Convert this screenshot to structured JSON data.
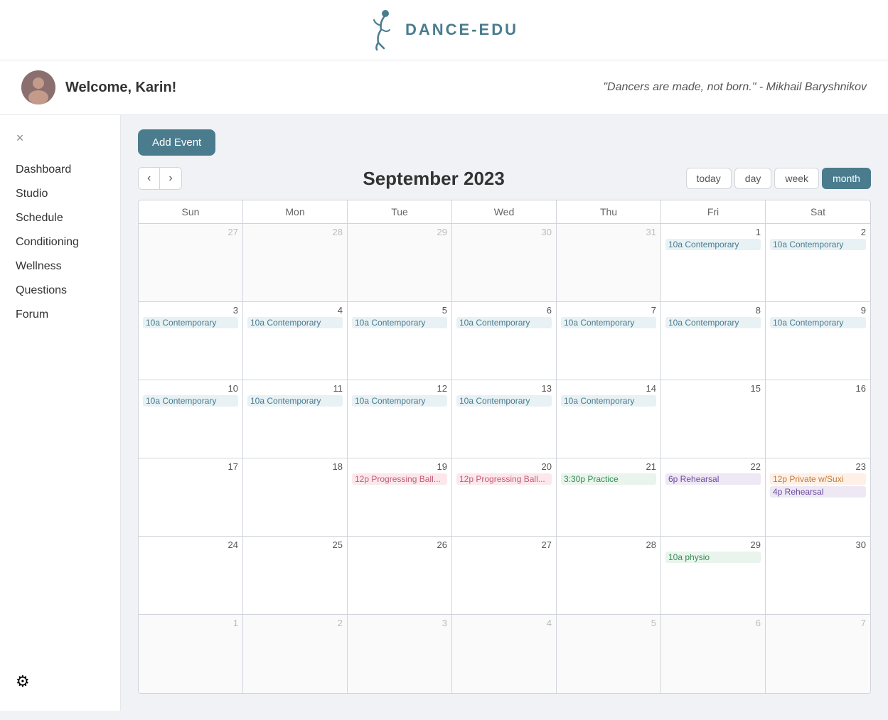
{
  "header": {
    "logo_text": "DANCE-EDU",
    "quote": "\"Dancers are made, not born.\" - Mikhail Baryshnikov",
    "welcome": "Welcome, Karin!"
  },
  "sidebar": {
    "close_icon": "×",
    "items": [
      {
        "label": "Dashboard",
        "id": "dashboard"
      },
      {
        "label": "Studio",
        "id": "studio"
      },
      {
        "label": "Schedule",
        "id": "schedule"
      },
      {
        "label": "Conditioning",
        "id": "conditioning"
      },
      {
        "label": "Wellness",
        "id": "wellness"
      },
      {
        "label": "Questions",
        "id": "questions"
      },
      {
        "label": "Forum",
        "id": "forum"
      }
    ],
    "settings_icon": "⚙"
  },
  "toolbar": {
    "add_event_label": "Add Event"
  },
  "calendar": {
    "month_title": "September 2023",
    "view_buttons": [
      {
        "label": "today",
        "id": "today",
        "active": false
      },
      {
        "label": "day",
        "id": "day",
        "active": false
      },
      {
        "label": "week",
        "id": "week",
        "active": false
      },
      {
        "label": "month",
        "id": "month",
        "active": true
      }
    ],
    "day_headers": [
      "Sun",
      "Mon",
      "Tue",
      "Wed",
      "Thu",
      "Fri",
      "Sat"
    ],
    "weeks": [
      [
        {
          "num": "27",
          "other": true,
          "events": []
        },
        {
          "num": "28",
          "other": true,
          "events": []
        },
        {
          "num": "29",
          "other": true,
          "events": []
        },
        {
          "num": "30",
          "other": true,
          "events": []
        },
        {
          "num": "31",
          "other": true,
          "events": []
        },
        {
          "num": "1",
          "other": false,
          "events": [
            {
              "label": "10a Contemporary",
              "type": "blue"
            }
          ]
        },
        {
          "num": "2",
          "other": false,
          "events": [
            {
              "label": "10a Contemporary",
              "type": "blue"
            }
          ]
        }
      ],
      [
        {
          "num": "3",
          "other": false,
          "events": [
            {
              "label": "10a Contemporary",
              "type": "blue"
            }
          ]
        },
        {
          "num": "4",
          "other": false,
          "events": [
            {
              "label": "10a Contemporary",
              "type": "blue"
            }
          ]
        },
        {
          "num": "5",
          "other": false,
          "events": [
            {
              "label": "10a Contemporary",
              "type": "blue"
            }
          ]
        },
        {
          "num": "6",
          "other": false,
          "events": [
            {
              "label": "10a Contemporary",
              "type": "blue"
            }
          ]
        },
        {
          "num": "7",
          "other": false,
          "events": [
            {
              "label": "10a Contemporary",
              "type": "blue"
            }
          ]
        },
        {
          "num": "8",
          "other": false,
          "events": [
            {
              "label": "10a Contemporary",
              "type": "blue"
            }
          ]
        },
        {
          "num": "9",
          "other": false,
          "events": [
            {
              "label": "10a Contemporary",
              "type": "blue"
            }
          ]
        }
      ],
      [
        {
          "num": "10",
          "other": false,
          "events": [
            {
              "label": "10a Contemporary",
              "type": "blue"
            }
          ]
        },
        {
          "num": "11",
          "other": false,
          "events": [
            {
              "label": "10a Contemporary",
              "type": "blue"
            }
          ]
        },
        {
          "num": "12",
          "other": false,
          "events": [
            {
              "label": "10a Contemporary",
              "type": "blue"
            }
          ]
        },
        {
          "num": "13",
          "other": false,
          "events": [
            {
              "label": "10a Contemporary",
              "type": "blue"
            }
          ]
        },
        {
          "num": "14",
          "other": false,
          "events": [
            {
              "label": "10a Contemporary",
              "type": "blue"
            }
          ]
        },
        {
          "num": "15",
          "other": false,
          "events": []
        },
        {
          "num": "16",
          "other": false,
          "events": []
        }
      ],
      [
        {
          "num": "17",
          "other": false,
          "events": []
        },
        {
          "num": "18",
          "other": false,
          "events": []
        },
        {
          "num": "19",
          "other": false,
          "events": [
            {
              "label": "12p Progressing Ball...",
              "type": "pink"
            }
          ]
        },
        {
          "num": "20",
          "other": false,
          "events": [
            {
              "label": "12p Progressing Ball...",
              "type": "pink"
            }
          ]
        },
        {
          "num": "21",
          "other": false,
          "events": [
            {
              "label": "3:30p Practice",
              "type": "green"
            }
          ]
        },
        {
          "num": "22",
          "other": false,
          "events": [
            {
              "label": "6p Rehearsal",
              "type": "purple"
            }
          ]
        },
        {
          "num": "23",
          "other": false,
          "events": [
            {
              "label": "12p Private w/Suxi",
              "type": "orange"
            },
            {
              "label": "4p Rehearsal",
              "type": "purple"
            }
          ]
        }
      ],
      [
        {
          "num": "24",
          "other": false,
          "events": []
        },
        {
          "num": "25",
          "other": false,
          "events": []
        },
        {
          "num": "26",
          "other": false,
          "events": []
        },
        {
          "num": "27",
          "other": false,
          "events": []
        },
        {
          "num": "28",
          "other": false,
          "events": []
        },
        {
          "num": "29",
          "other": false,
          "events": [
            {
              "label": "10a physio",
              "type": "green"
            }
          ]
        },
        {
          "num": "30",
          "other": false,
          "events": []
        }
      ],
      [
        {
          "num": "1",
          "other": true,
          "events": []
        },
        {
          "num": "2",
          "other": true,
          "events": []
        },
        {
          "num": "3",
          "other": true,
          "events": []
        },
        {
          "num": "4",
          "other": true,
          "events": []
        },
        {
          "num": "5",
          "other": true,
          "events": []
        },
        {
          "num": "6",
          "other": true,
          "events": []
        },
        {
          "num": "7",
          "other": true,
          "events": []
        }
      ]
    ]
  }
}
